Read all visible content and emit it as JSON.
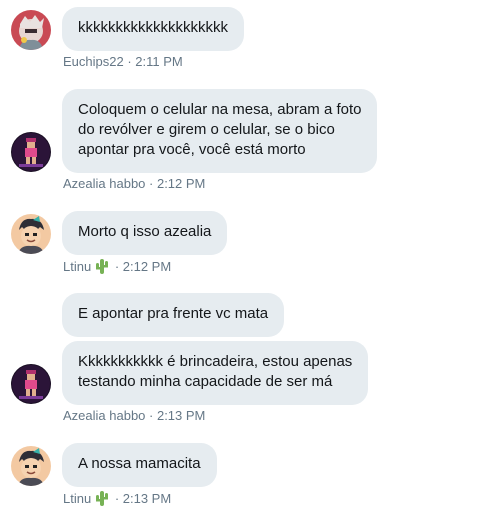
{
  "messages": [
    {
      "lines": [
        "kkkkkkkkkkkkkkkkkkkk"
      ],
      "author": "Euchips22",
      "time": "2:11 PM"
    },
    {
      "lines": [
        "Coloquem o celular na mesa, abram a foto",
        "do revólver e girem o celular, se o bico",
        "apontar pra você, você está morto"
      ],
      "author": "Azealia habbo",
      "time": "2:12 PM"
    },
    {
      "lines": [
        "Morto q isso azealia"
      ],
      "author": "Ltinu",
      "time": "2:12 PM",
      "author_emoji": "cactus-icon"
    },
    {
      "lines": [
        "E apontar pra frente vc mata"
      ]
    },
    {
      "lines": [
        "Kkkkkkkkkkk é brincadeira, estou apenas",
        "testando minha capacidade de ser má"
      ],
      "author": "Azealia habbo",
      "time": "2:13 PM"
    },
    {
      "lines": [
        "A nossa mamacita"
      ],
      "author": "Ltinu",
      "time": "2:13 PM",
      "author_emoji": "cactus-icon"
    }
  ],
  "separator": " · ",
  "colors": {
    "bubble_bg": "#e6ecf0",
    "text": "#14171a",
    "meta": "#657786"
  }
}
